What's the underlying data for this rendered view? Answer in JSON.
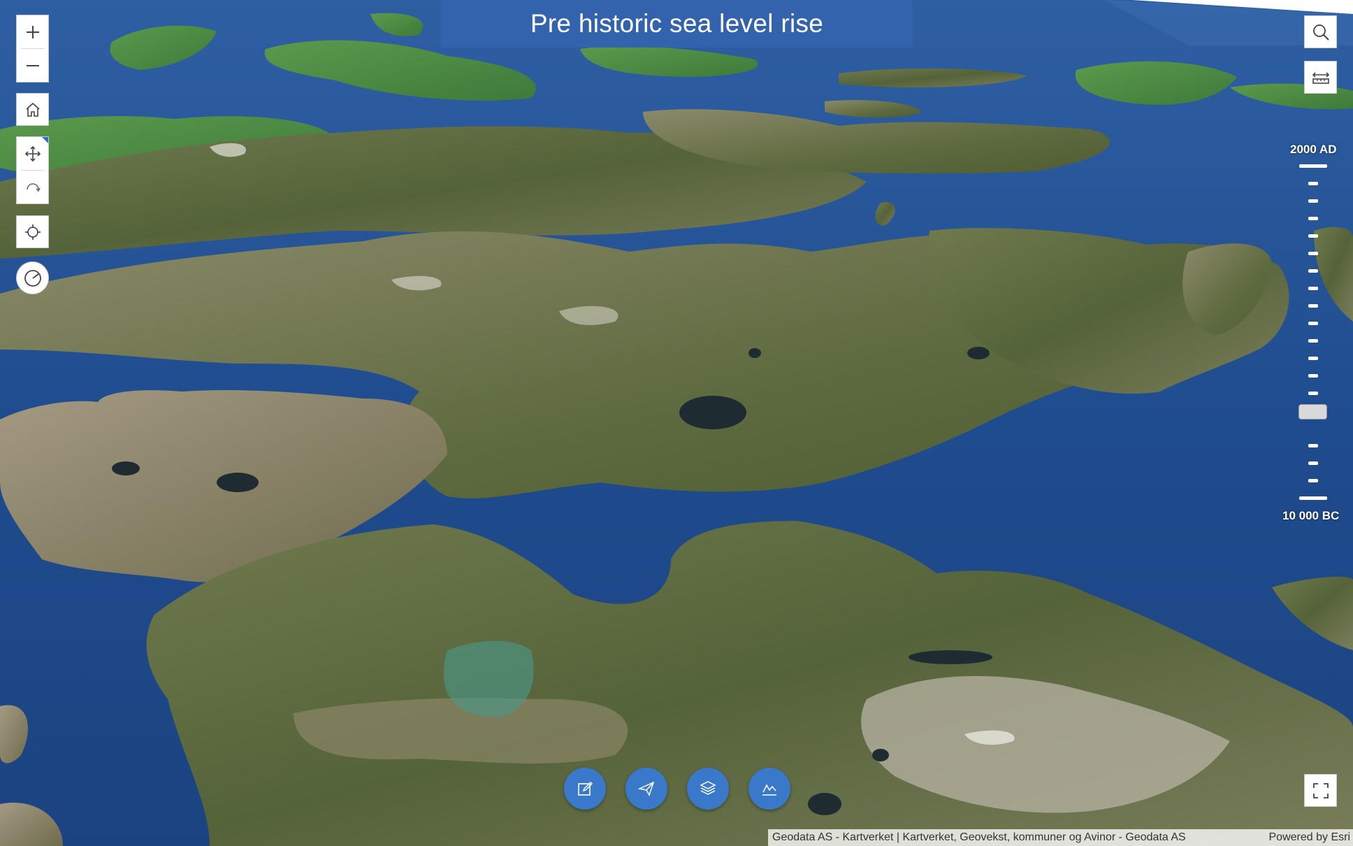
{
  "title": "Pre historic sea level rise",
  "left_toolbar": {
    "zoom_in": "zoom-in-icon",
    "zoom_out": "zoom-out-icon",
    "home": "home-icon",
    "pan": "pan-icon",
    "rotate": "rotate-icon",
    "locate": "locate-icon",
    "compass": "compass-icon"
  },
  "right_toolbar": {
    "search": "search-icon",
    "measure": "measure-icon",
    "fullscreen": "fullscreen-icon"
  },
  "time_slider": {
    "top_label": "2000 AD",
    "bottom_label": "10 000 BC",
    "position_fraction_from_top": 0.74
  },
  "bottom_actions": [
    {
      "name": "edit-icon"
    },
    {
      "name": "send-icon"
    },
    {
      "name": "layers-icon"
    },
    {
      "name": "chart-icon"
    }
  ],
  "attribution": {
    "text": "Geodata AS - Kartverket | Kartverket, Geovekst, kommuner og Avinor - Geodata AS",
    "powered_by": "Powered by Esri"
  },
  "colors": {
    "water": "#1f4f8f",
    "banner": "#3463ad",
    "action_button": "#3a78c9"
  }
}
